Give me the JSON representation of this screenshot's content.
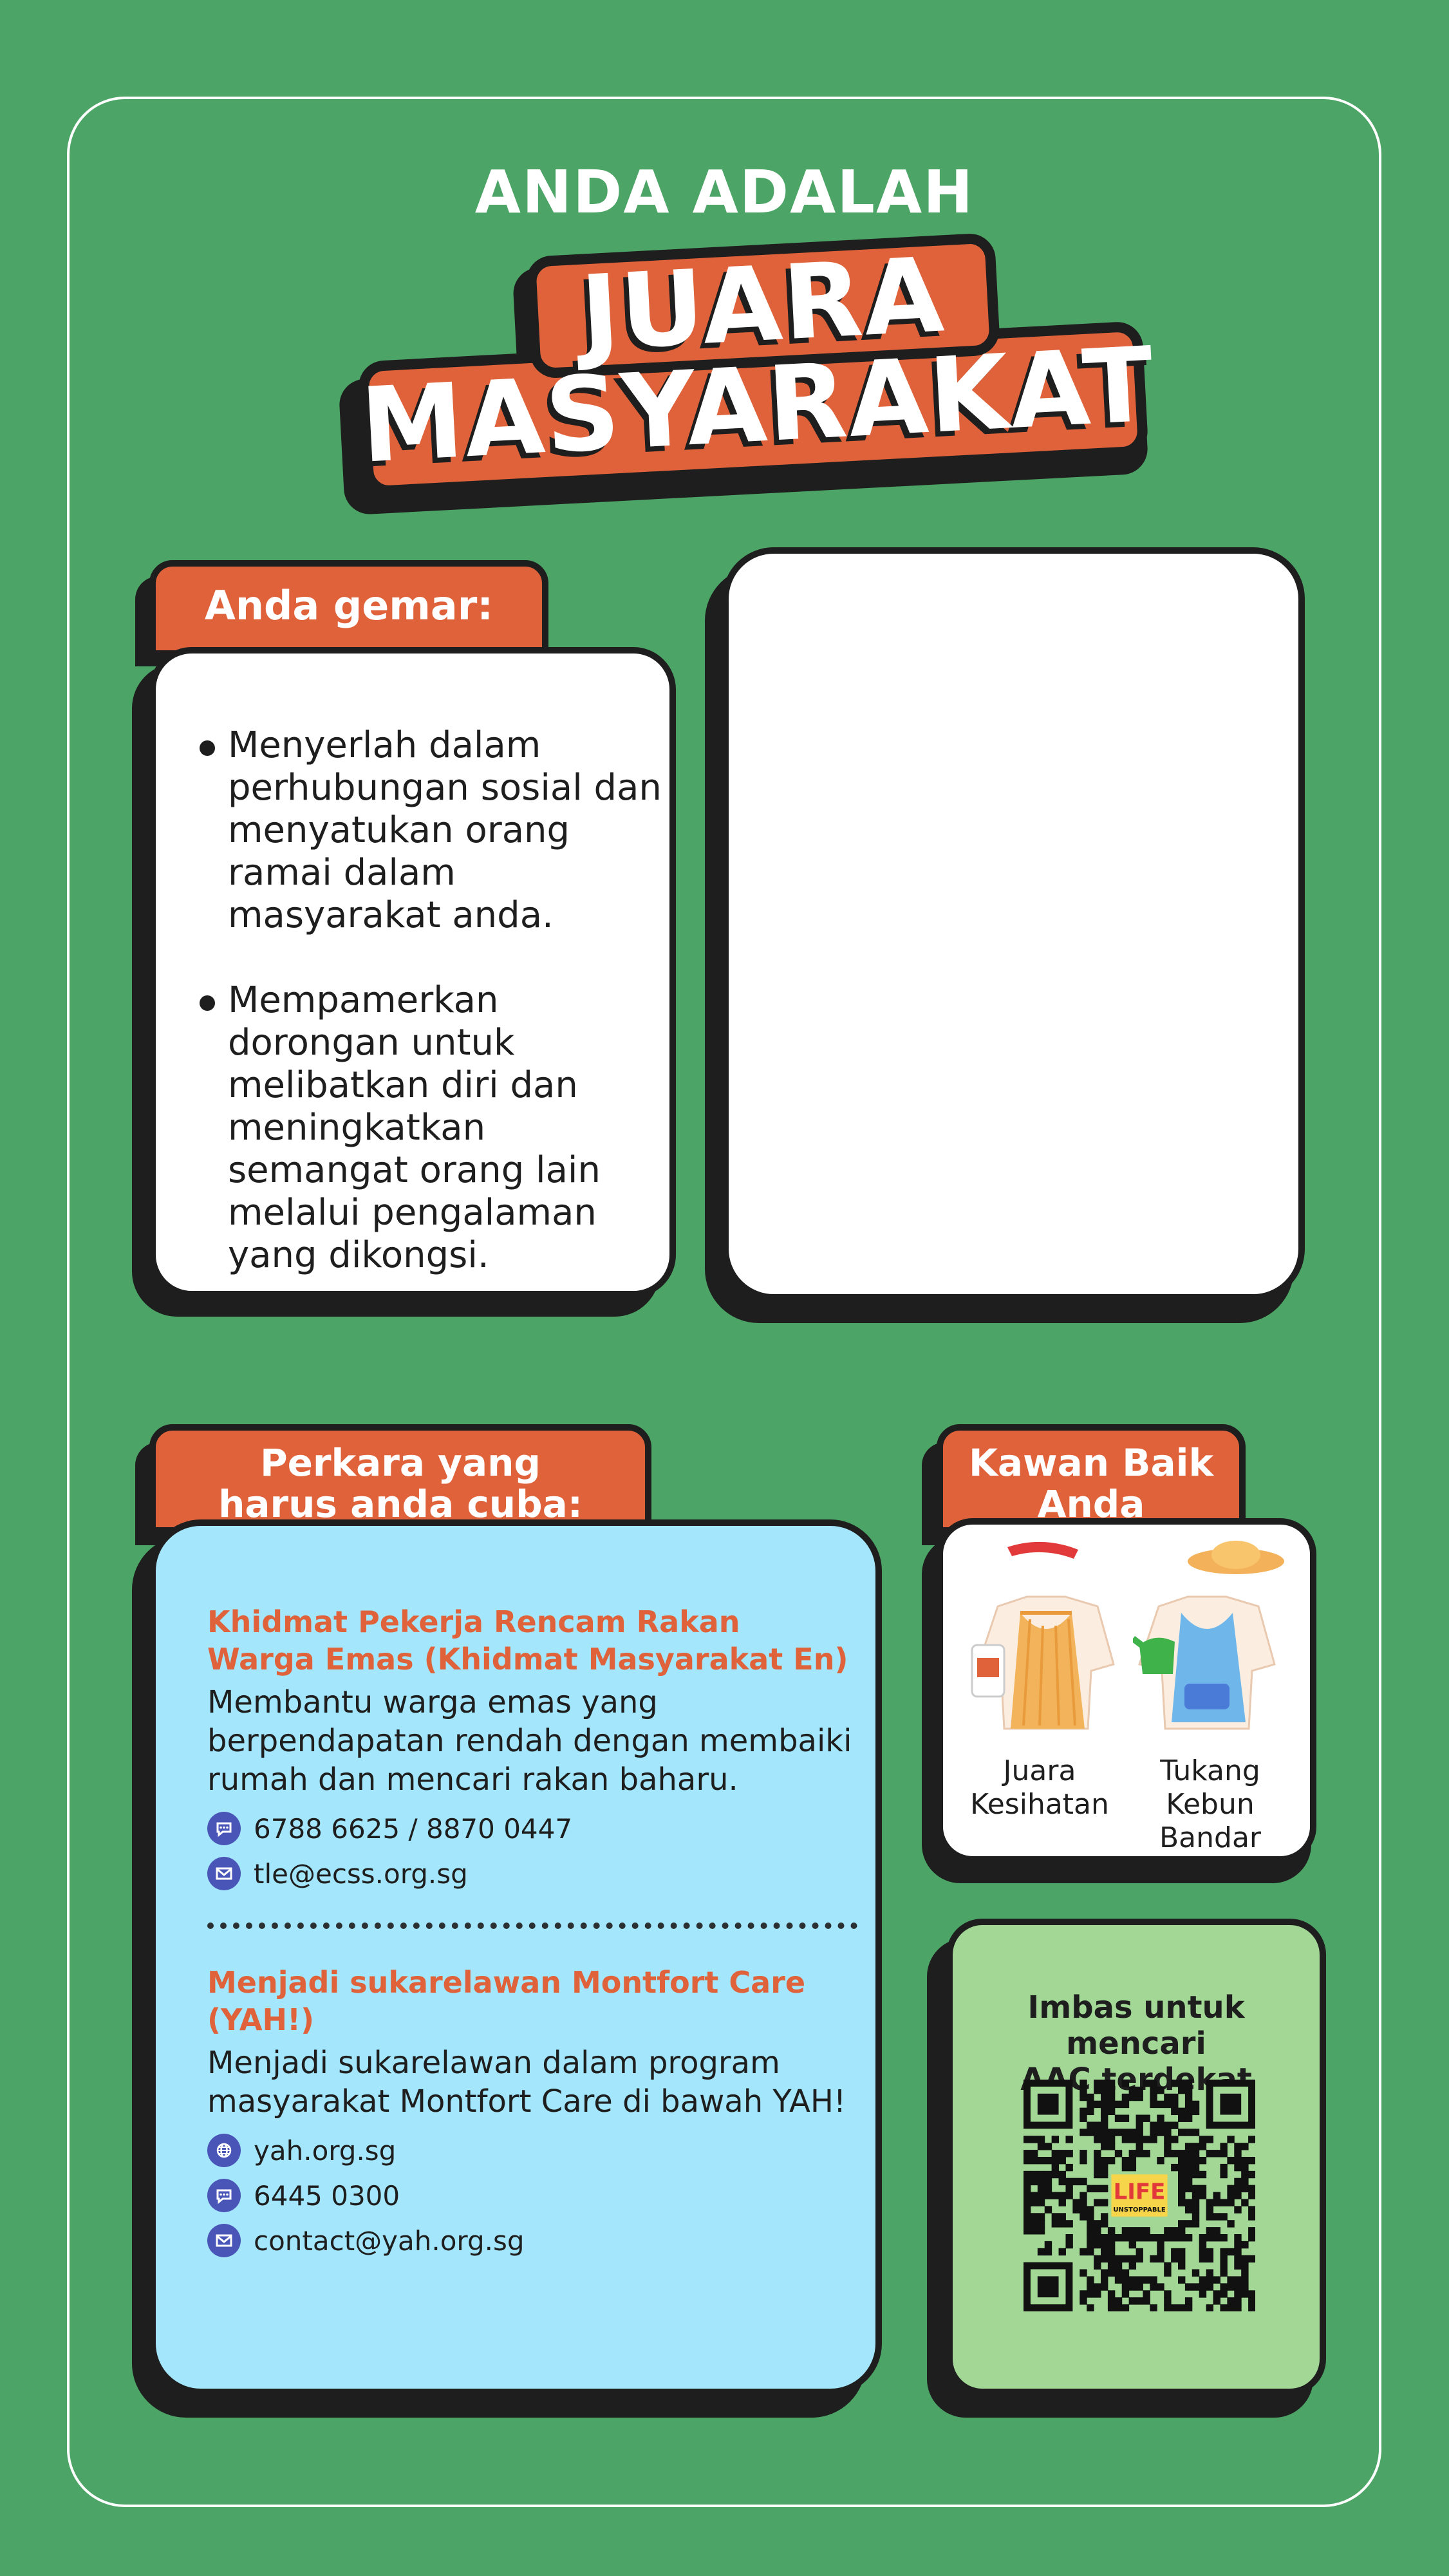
{
  "colors": {
    "background": "#4ca466",
    "accent": "#e0623a",
    "dark": "#1e1e1e",
    "blue_panel": "#a4e6fb",
    "green_panel": "#a2d795",
    "icon_blue": "#4a55b8"
  },
  "header": {
    "intro": "ANDA ADALAH",
    "title_line1": "JUARA",
    "title_line2": "MASYARAKAT"
  },
  "likes": {
    "tab_label": "Anda gemar:",
    "items": [
      "Menyerlah dalam perhubungan sosial dan menyatukan orang ramai dalam masyarakat anda.",
      "Mempamerkan dorongan untuk melibatkan diri dan meningkatkan semangat orang lain melalui pengalaman yang dikongsi."
    ]
  },
  "try": {
    "tab_line1": "Perkara yang",
    "tab_line2": "harus anda cuba:",
    "services": [
      {
        "title_line1": "Khidmat Pekerja Rencam Rakan",
        "title_line2": "Warga Emas (Khidmat Masyarakat En)",
        "desc": "Membantu warga emas yang berpendapatan rendah dengan membaiki rumah dan mencari rakan baharu.",
        "contacts": [
          {
            "icon": "chat-icon",
            "text": "6788 6625 / 8870 0447"
          },
          {
            "icon": "mail-icon",
            "text": "tle@ecss.org.sg"
          }
        ]
      },
      {
        "title_line1": "Menjadi sukarelawan Montfort Care (YAH!)",
        "desc": "Menjadi sukarelawan dalam program masyarakat Montfort Care di bawah YAH!",
        "contacts": [
          {
            "icon": "globe-icon",
            "text": "yah.org.sg"
          },
          {
            "icon": "chat-icon",
            "text": "6445 0300"
          },
          {
            "icon": "mail-icon",
            "text": "contact@yah.org.sg"
          }
        ]
      }
    ]
  },
  "friends": {
    "tab_line1": "Kawan Baik",
    "tab_line2": "Anda",
    "items": [
      {
        "line1": "Juara",
        "line2": "Kesihatan",
        "icon": "health-champion-apron-icon"
      },
      {
        "line1": "Tukang",
        "line2": "Kebun Bandar",
        "icon": "urban-gardener-apron-icon"
      }
    ]
  },
  "qr": {
    "line1": "Imbas untuk mencari",
    "line2": "AAC terdekat",
    "logo_line1": "LIFE",
    "logo_line2": "UNSTOPPABLE"
  }
}
